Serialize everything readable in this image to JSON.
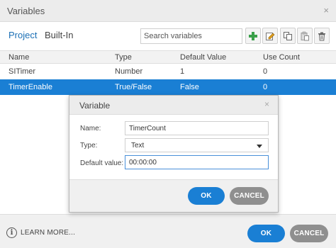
{
  "window": {
    "title": "Variables",
    "close_glyph": "×"
  },
  "tabs": [
    {
      "label": "Project"
    },
    {
      "label": "Built-In"
    }
  ],
  "search": {
    "placeholder": "Search variables",
    "value": ""
  },
  "toolbar": [
    {
      "name": "add-icon"
    },
    {
      "name": "edit-icon"
    },
    {
      "name": "copy-icon"
    },
    {
      "name": "paste-icon"
    },
    {
      "name": "delete-icon"
    }
  ],
  "table": {
    "columns": [
      "Name",
      "Type",
      "Default Value",
      "Use Count"
    ],
    "rows": [
      [
        "SITimer",
        "Number",
        "1",
        "0"
      ],
      [
        "TimerEnable",
        "True/False",
        "False",
        "0"
      ]
    ],
    "selected_row": 1
  },
  "footer": {
    "learn_more": "LEARN MORE...",
    "ok": "OK",
    "cancel": "CANCEL"
  },
  "dialog": {
    "title": "Variable",
    "close_glyph": "×",
    "name_label": "Name:",
    "name_value": "TimerCount",
    "type_label": "Type:",
    "type_value": "Text",
    "default_label": "Default value:",
    "default_value": "00:00:00",
    "ok": "OK",
    "cancel": "CANCEL"
  },
  "colors": {
    "accent": "#1a7fd4",
    "add_green": "#3aa04a",
    "secondary_button": "#8f8f8f"
  }
}
